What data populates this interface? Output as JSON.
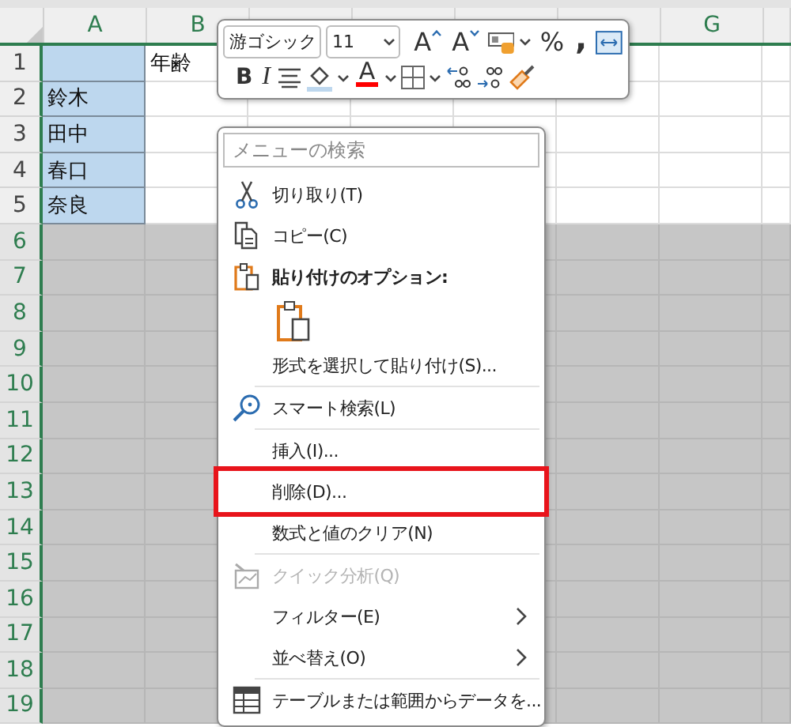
{
  "sheet": {
    "columns": [
      {
        "label": "A"
      },
      {
        "label": "B"
      },
      {},
      {},
      {},
      {},
      {
        "label": "G"
      },
      {}
    ],
    "rows": [
      {
        "label": "1",
        "selected": false,
        "cells": [
          {
            "selected": true
          },
          {
            "text": "年齢",
            "selected": false
          }
        ]
      },
      {
        "label": "2",
        "selected": false,
        "cells": [
          {
            "text": "鈴木",
            "selected": true
          },
          {
            "selected": false
          }
        ]
      },
      {
        "label": "3",
        "selected": false,
        "cells": [
          {
            "text": "田中",
            "selected": true
          },
          {
            "selected": false
          }
        ]
      },
      {
        "label": "4",
        "selected": false,
        "cells": [
          {
            "text": "春口",
            "selected": true
          },
          {
            "selected": false
          }
        ]
      },
      {
        "label": "5",
        "selected": false,
        "cells": [
          {
            "text": "奈良",
            "selected": true
          },
          {
            "selected": false
          }
        ]
      },
      {
        "label": "6",
        "selected": true
      },
      {
        "label": "7",
        "selected": true
      },
      {
        "label": "8",
        "selected": true
      },
      {
        "label": "9",
        "selected": true
      },
      {
        "label": "10",
        "selected": true
      },
      {
        "label": "11",
        "selected": true
      },
      {
        "label": "12",
        "selected": true
      },
      {
        "label": "13",
        "selected": true
      },
      {
        "label": "14",
        "selected": true
      },
      {
        "label": "15",
        "selected": true
      },
      {
        "label": "16",
        "selected": true
      },
      {
        "label": "17",
        "selected": true
      },
      {
        "label": "18",
        "selected": true
      },
      {
        "label": "19",
        "selected": true
      }
    ]
  },
  "mini_toolbar": {
    "top_row": [
      {
        "kind": "dropdown",
        "value": "游ゴシック"
      },
      {
        "kind": "dropdown",
        "value": "11"
      },
      {
        "kind": "grow",
        "label": "A"
      },
      {
        "kind": "shrink",
        "label": "A"
      },
      {
        "kind": "format"
      },
      {
        "kind": "caret"
      },
      {
        "kind": "glyph",
        "label": "%"
      },
      {
        "kind": "comma",
        "label": ","
      },
      {
        "kind": "wrap"
      }
    ],
    "bottom_row": [
      {
        "kind": "bold",
        "label": "B"
      },
      {
        "kind": "italic",
        "label": "I"
      },
      {
        "kind": "align"
      },
      {
        "kind": "fill",
        "color": "#bdd7ee"
      },
      {
        "kind": "caret"
      },
      {
        "kind": "font-color",
        "label": "A",
        "color": "#ff0000"
      },
      {
        "kind": "caret"
      },
      {
        "kind": "borders"
      },
      {
        "kind": "caret"
      },
      {
        "kind": "inc-decimal"
      },
      {
        "kind": "dec-decimal"
      },
      {
        "kind": "painter"
      }
    ]
  },
  "context_menu": {
    "items": [
      {
        "kind": "search",
        "placeholder": "メニューの検索"
      },
      {
        "kind": "cut",
        "label": "切り取り(T)",
        "disabled": false,
        "highlighted": false,
        "submenu": false
      },
      {
        "kind": "copy",
        "label": "コピー(C)",
        "disabled": false,
        "highlighted": false,
        "submenu": false
      },
      {
        "kind": "paste-header",
        "label": "貼り付けのオプション:"
      },
      {
        "kind": "paste-option"
      },
      {
        "kind": "plain",
        "label": "形式を選択して貼り付け(S)...",
        "disabled": false,
        "highlighted": false,
        "submenu": false
      },
      {
        "kind": "separator"
      },
      {
        "kind": "lookup",
        "label": "スマート検索(L)",
        "disabled": false,
        "highlighted": false,
        "submenu": false
      },
      {
        "kind": "separator"
      },
      {
        "kind": "plain",
        "label": "挿入(I)...",
        "disabled": false,
        "highlighted": false,
        "submenu": false
      },
      {
        "kind": "plain",
        "label": "削除(D)...",
        "disabled": false,
        "highlighted": true,
        "submenu": false
      },
      {
        "kind": "plain",
        "label": "数式と値のクリア(N)",
        "disabled": false,
        "highlighted": false,
        "submenu": false
      },
      {
        "kind": "separator"
      },
      {
        "kind": "analysis",
        "label": "クイック分析(Q)",
        "disabled": true,
        "highlighted": false,
        "submenu": false
      },
      {
        "kind": "plain",
        "label": "フィルター(E)",
        "disabled": false,
        "highlighted": false,
        "submenu": true
      },
      {
        "kind": "plain",
        "label": "並べ替え(O)",
        "disabled": false,
        "highlighted": false,
        "submenu": true
      },
      {
        "kind": "separator"
      },
      {
        "kind": "table",
        "label": "テーブルまたは範囲からデータを...",
        "disabled": false,
        "highlighted": false,
        "submenu": false
      }
    ]
  }
}
